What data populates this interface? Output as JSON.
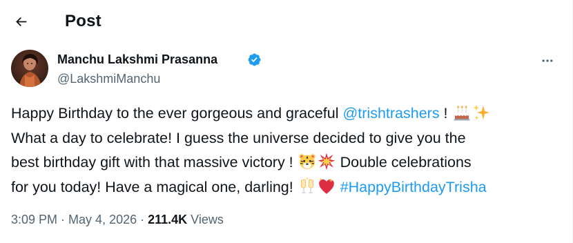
{
  "header": {
    "title": "Post"
  },
  "author": {
    "name": "Manchu Lakshmi Prasanna",
    "handle": "@LakshmiManchu",
    "verified": true
  },
  "tweet": {
    "line1_text": "Happy Birthday to the ever gorgeous and graceful ",
    "mention": "@trishtrashers",
    "line1_end": " !",
    "line2": "What a day to celebrate! I guess the universe decided to give you the",
    "line3": "best birthday gift with that massive victory !",
    "line3_end": "Double celebrations",
    "line4": "for you today! Have a magical one, darling!",
    "hashtag": "#HappyBirthdayTrisha",
    "emojis": [
      "birthday-cake",
      "sparkles",
      "tiger-face",
      "collision",
      "clinking-glasses",
      "sparkling-heart"
    ]
  },
  "meta": {
    "time": "3:09 PM",
    "separator": " · ",
    "date": "May 4, 2026",
    "views_count": "211.4K",
    "views_label": " Views"
  },
  "colors": {
    "link": "#1d9bf0",
    "text": "#0f1419",
    "muted": "#536471",
    "verified": "#1d9bf0"
  }
}
